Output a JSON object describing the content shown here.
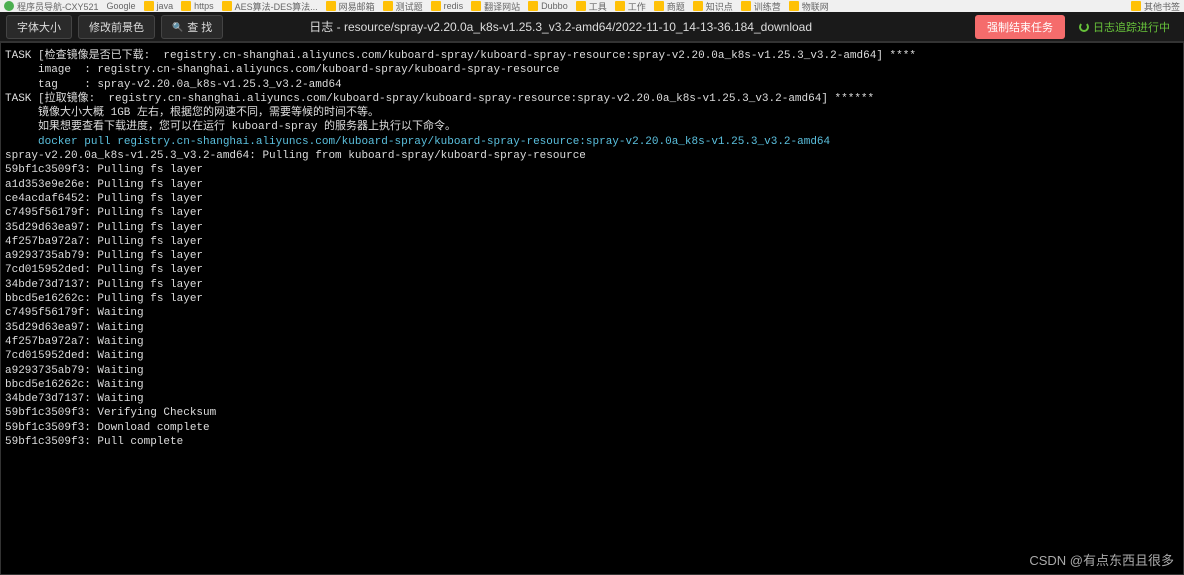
{
  "bookmarks": [
    "程序员导航-CXY521",
    "Google",
    "java",
    "https",
    "AES算法-DES算法...",
    "网易邮箱",
    "测试题",
    "redis",
    "翻译网站",
    "Dubbo",
    "工具",
    "工作",
    "商题",
    "知识点",
    "训练营",
    "物联网",
    "其他书签"
  ],
  "toolbar": {
    "font_size": "字体大小",
    "change_colors": "修改前景色",
    "search": "查 找"
  },
  "title": "日志 - resource/spray-v2.20.0a_k8s-v1.25.3_v3.2-amd64/2022-11-10_14-13-36.184_download",
  "actions": {
    "force_end": "强制结束任务",
    "tracking": "日志追踪进行中"
  },
  "terminal_lines": [
    {
      "text": "TASK [检查镜像是否已下载:  registry.cn-shanghai.aliyuncs.com/kuboard-spray/kuboard-spray-resource:spray-v2.20.0a_k8s-v1.25.3_v3.2-amd64] ****",
      "cls": ""
    },
    {
      "text": "     image  : registry.cn-shanghai.aliyuncs.com/kuboard-spray/kuboard-spray-resource",
      "cls": ""
    },
    {
      "text": "     tag    : spray-v2.20.0a_k8s-v1.25.3_v3.2-amd64",
      "cls": ""
    },
    {
      "text": "",
      "cls": ""
    },
    {
      "text": "TASK [拉取镜像:  registry.cn-shanghai.aliyuncs.com/kuboard-spray/kuboard-spray-resource:spray-v2.20.0a_k8s-v1.25.3_v3.2-amd64] ******",
      "cls": ""
    },
    {
      "text": "     镜像大小大概 1GB 左右，根据您的网速不同，需要等候的时间不等。",
      "cls": ""
    },
    {
      "text": "     如果想要查看下载进度，您可以在运行 kuboard-spray 的服务器上执行以下命令。",
      "cls": ""
    },
    {
      "text": "     docker pull registry.cn-shanghai.aliyuncs.com/kuboard-spray/kuboard-spray-resource:spray-v2.20.0a_k8s-v1.25.3_v3.2-amd64",
      "cls": "cyan"
    },
    {
      "text": "",
      "cls": ""
    },
    {
      "text": "spray-v2.20.0a_k8s-v1.25.3_v3.2-amd64: Pulling from kuboard-spray/kuboard-spray-resource",
      "cls": ""
    },
    {
      "text": "59bf1c3509f3: Pulling fs layer",
      "cls": ""
    },
    {
      "text": "a1d353e9e26e: Pulling fs layer",
      "cls": ""
    },
    {
      "text": "ce4acdaf6452: Pulling fs layer",
      "cls": ""
    },
    {
      "text": "c7495f56179f: Pulling fs layer",
      "cls": ""
    },
    {
      "text": "35d29d63ea97: Pulling fs layer",
      "cls": ""
    },
    {
      "text": "4f257ba972a7: Pulling fs layer",
      "cls": ""
    },
    {
      "text": "a9293735ab79: Pulling fs layer",
      "cls": ""
    },
    {
      "text": "7cd015952ded: Pulling fs layer",
      "cls": ""
    },
    {
      "text": "34bde73d7137: Pulling fs layer",
      "cls": ""
    },
    {
      "text": "bbcd5e16262c: Pulling fs layer",
      "cls": ""
    },
    {
      "text": "c7495f56179f: Waiting",
      "cls": ""
    },
    {
      "text": "35d29d63ea97: Waiting",
      "cls": ""
    },
    {
      "text": "4f257ba972a7: Waiting",
      "cls": ""
    },
    {
      "text": "7cd015952ded: Waiting",
      "cls": ""
    },
    {
      "text": "a9293735ab79: Waiting",
      "cls": ""
    },
    {
      "text": "bbcd5e16262c: Waiting",
      "cls": ""
    },
    {
      "text": "34bde73d7137: Waiting",
      "cls": ""
    },
    {
      "text": "59bf1c3509f3: Verifying Checksum",
      "cls": ""
    },
    {
      "text": "59bf1c3509f3: Download complete",
      "cls": ""
    },
    {
      "text": "59bf1c3509f3: Pull complete",
      "cls": ""
    }
  ],
  "watermark": "CSDN @有点东西且很多"
}
